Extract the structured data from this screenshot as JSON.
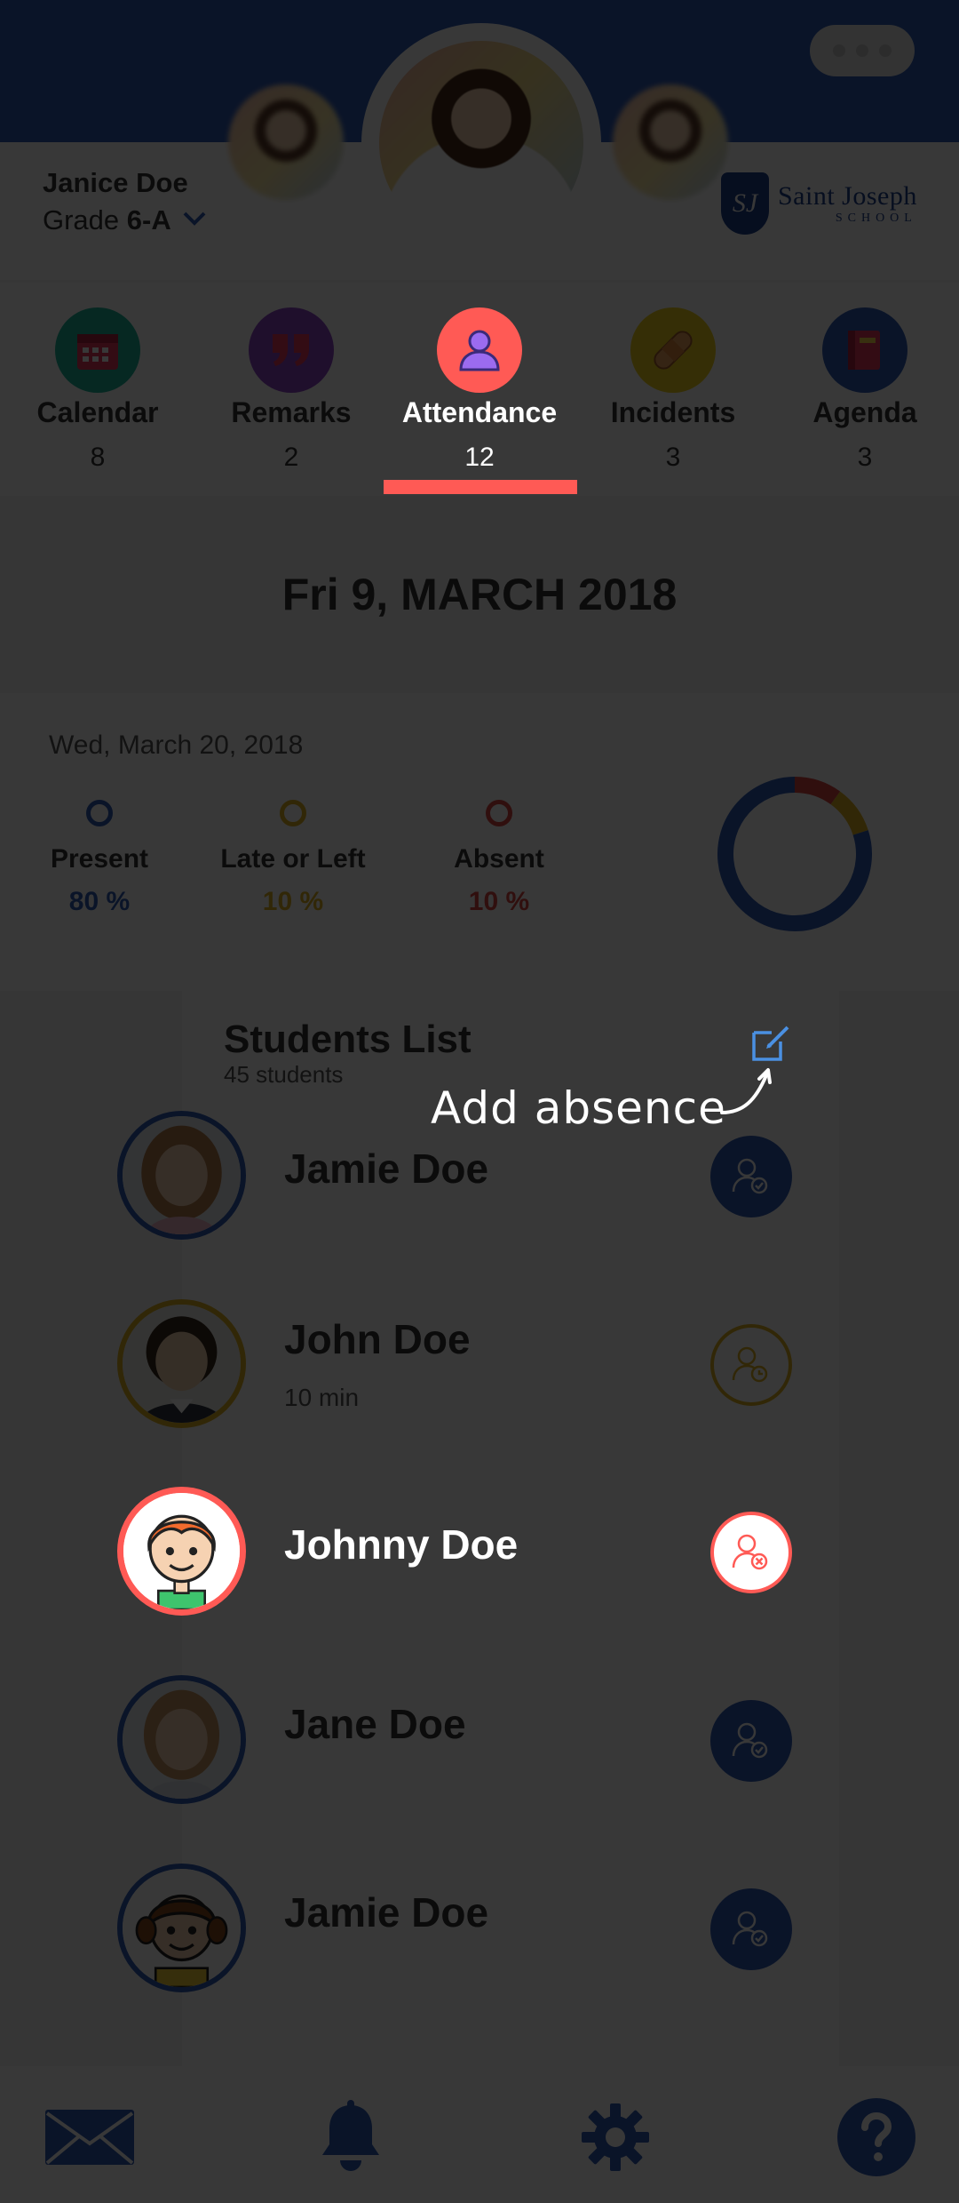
{
  "header": {
    "menu_icon": "more-dots-icon",
    "teacher_name": "Janice Doe",
    "grade_prefix": "Grade",
    "grade_value": "6-A",
    "school_name_line1": "Saint Joseph",
    "school_name_line2": "SCHOOL",
    "school_monogram": "SJ"
  },
  "tabs": [
    {
      "label": "Calendar",
      "count": "8",
      "icon": "calendar-icon",
      "color": "#1fb59a"
    },
    {
      "label": "Remarks",
      "count": "2",
      "icon": "quote-icon",
      "color": "#8e44c8"
    },
    {
      "label": "Attendance",
      "count": "12",
      "icon": "person-icon",
      "color": "#ff5a55",
      "active": true
    },
    {
      "label": "Incidents",
      "count": "3",
      "icon": "bandage-icon",
      "color": "#f2d21b"
    },
    {
      "label": "Agenda",
      "count": "3",
      "icon": "book-icon",
      "color": "#2f5bb8"
    }
  ],
  "date_heading": "Fri 9, MARCH 2018",
  "stats": {
    "date": "Wed, March 20, 2018",
    "present_label": "Present",
    "present_value": "80 %",
    "late_label": "Late or Left",
    "late_value": "10 %",
    "absent_label": "Absent",
    "absent_value": "10 %",
    "colors": {
      "present": "#2f5bb8",
      "late": "#e0b021",
      "absent": "#d9463f"
    },
    "donut_fractions": {
      "present": 0.8,
      "late": 0.1,
      "absent": 0.1
    }
  },
  "students": {
    "title": "Students List",
    "count_text": "45 students",
    "add_absence_label": "Add absence",
    "items": [
      {
        "name": "Jamie Doe",
        "sub": "",
        "status": "present",
        "avatar": "girl-photo"
      },
      {
        "name": "John Doe",
        "sub": "10 min",
        "status": "late",
        "avatar": "boy-photo"
      },
      {
        "name": "Johnny Doe",
        "sub": "",
        "status": "absent",
        "avatar": "cartoon-boy"
      },
      {
        "name": "Jane Doe",
        "sub": "",
        "status": "present",
        "avatar": "girl-photo"
      },
      {
        "name": "Jamie Doe",
        "sub": "",
        "status": "present",
        "avatar": "cartoon-girl"
      }
    ]
  },
  "bottom_nav": [
    {
      "icon": "mail-icon"
    },
    {
      "icon": "bell-icon"
    },
    {
      "icon": "settings-icon"
    },
    {
      "icon": "help-icon"
    }
  ]
}
